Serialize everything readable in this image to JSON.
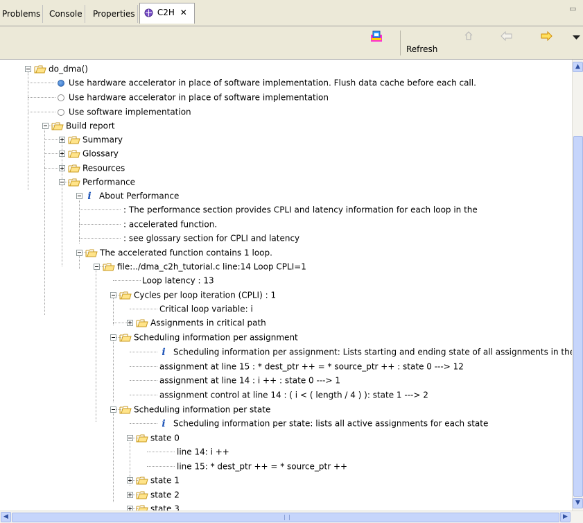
{
  "tabs": [
    {
      "label": "Problems"
    },
    {
      "label": "Console"
    },
    {
      "label": "Properties"
    },
    {
      "label": "C2H",
      "active": true,
      "close": "✕"
    }
  ],
  "toolbar": {
    "refresh_label": "Refresh"
  },
  "tree": {
    "rows": [
      {
        "text": "do_dma()",
        "kind": "folder",
        "toggle": "minus"
      },
      {
        "text": "Use hardware accelerator in place of software implementation. Flush data cache before each call.",
        "kind": "radio",
        "checked": true
      },
      {
        "text": "Use hardware accelerator in place of software implementation",
        "kind": "radio"
      },
      {
        "text": "Use software implementation",
        "kind": "radio"
      },
      {
        "text": "Build report",
        "kind": "folder",
        "toggle": "minus"
      },
      {
        "text": "Summary",
        "kind": "folder",
        "toggle": "plus"
      },
      {
        "text": "Glossary",
        "kind": "folder",
        "toggle": "plus"
      },
      {
        "text": "Resources",
        "kind": "folder",
        "toggle": "plus"
      },
      {
        "text": "Performance",
        "kind": "folder",
        "toggle": "minus"
      },
      {
        "text": "About Performance",
        "kind": "info",
        "toggle": "minus"
      },
      {
        "text": ": The performance section provides CPLI and latency information for each loop in the",
        "kind": "text"
      },
      {
        "text": ": accelerated function.",
        "kind": "text"
      },
      {
        "text": ": see glossary section for CPLI and latency",
        "kind": "text"
      },
      {
        "text": "The accelerated function contains 1 loop.",
        "kind": "folder",
        "toggle": "minus"
      },
      {
        "text": "file:../dma_c2h_tutorial.c line:14 Loop CPLI=1",
        "kind": "folder",
        "toggle": "minus"
      },
      {
        "text": "Loop latency :  13",
        "kind": "text"
      },
      {
        "text": "Cycles per loop iteration (CPLI) : 1",
        "kind": "folder",
        "toggle": "minus"
      },
      {
        "text": "Critical loop variable: i",
        "kind": "text"
      },
      {
        "text": "Assignments in critical path",
        "kind": "folder",
        "toggle": "plus"
      },
      {
        "text": "Scheduling information per assignment",
        "kind": "folder",
        "toggle": "minus"
      },
      {
        "text": "Scheduling information per assignment: Lists starting and ending state of all assignments in the lo",
        "kind": "info"
      },
      {
        "text": "assignment at line 15 :  * dest_ptr ++  =  * source_ptr ++ : state 0 --->  12",
        "kind": "text"
      },
      {
        "text": "assignment at line 14 : i ++ : state 0 --->  1",
        "kind": "text"
      },
      {
        "text": "assignment control at line 14 : ( i < ( length / 4 ) ): state 1 --->  2",
        "kind": "text"
      },
      {
        "text": "Scheduling information per state",
        "kind": "folder",
        "toggle": "minus"
      },
      {
        "text": "Scheduling information per state: lists all active assignments for each state",
        "kind": "info"
      },
      {
        "text": "state 0",
        "kind": "folder",
        "toggle": "minus"
      },
      {
        "text": "line 14: i ++",
        "kind": "text"
      },
      {
        "text": "line 15:  * dest_ptr ++  =  * source_ptr ++",
        "kind": "text"
      },
      {
        "text": "state 1",
        "kind": "folder",
        "toggle": "plus"
      },
      {
        "text": "state 2",
        "kind": "folder",
        "toggle": "plus"
      },
      {
        "text": "state 3",
        "kind": "folder",
        "toggle": "plus"
      }
    ]
  }
}
